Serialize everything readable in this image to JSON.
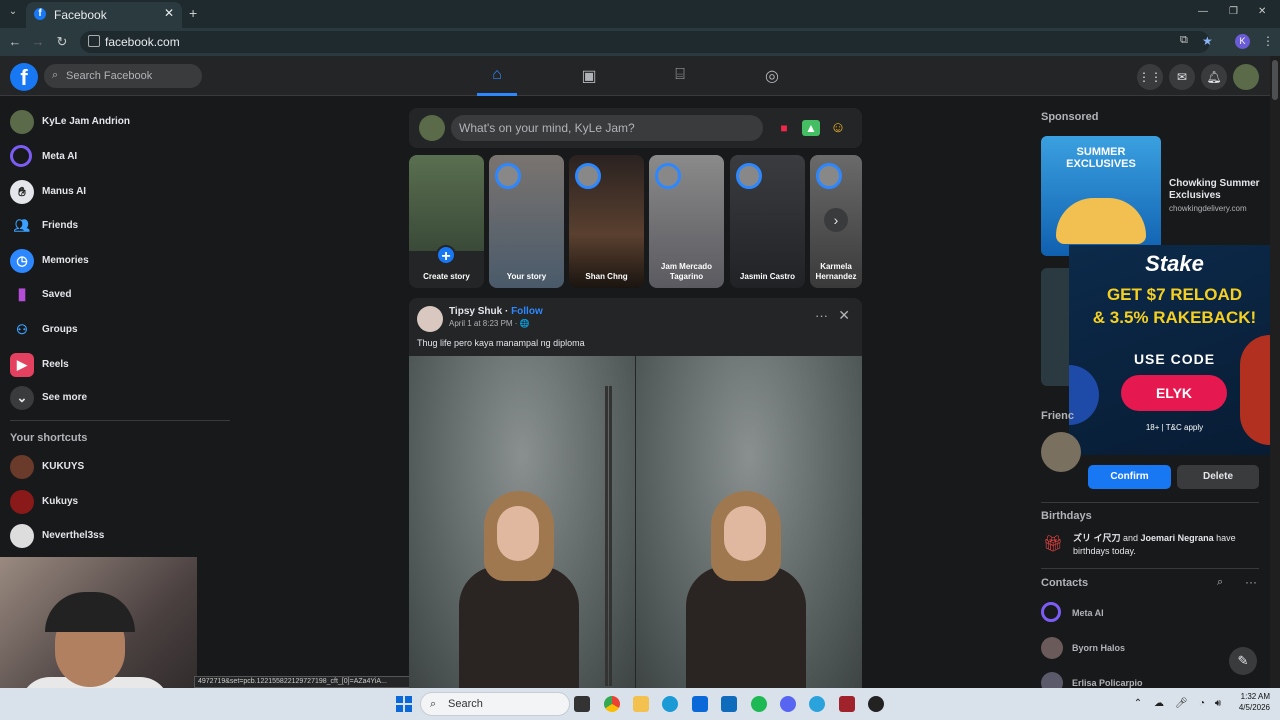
{
  "browser": {
    "tab_title": "Facebook",
    "tab_favicon": "f",
    "new_tab": "+",
    "url": "facebook.com",
    "profile_initial": "K",
    "window_controls": {
      "minimize": "—",
      "restore": "❐",
      "close": "✕"
    }
  },
  "header": {
    "logo": "f",
    "search_placeholder": "Search Facebook",
    "nav": [
      "home-icon",
      "video-icon",
      "marketplace-icon",
      "groups-icon"
    ]
  },
  "sidebar": {
    "items": [
      {
        "label": "KyLe Jam Andrion",
        "icon": "avatar"
      },
      {
        "label": "Meta AI",
        "icon": "meta-ai-icon"
      },
      {
        "label": "Manus AI",
        "icon": "manus-icon"
      },
      {
        "label": "Friends",
        "icon": "friends-icon"
      },
      {
        "label": "Memories",
        "icon": "clock-icon"
      },
      {
        "label": "Saved",
        "icon": "bookmark-icon"
      },
      {
        "label": "Groups",
        "icon": "groups-icon"
      },
      {
        "label": "Reels",
        "icon": "reels-icon"
      },
      {
        "label": "See more",
        "icon": "chevron-down-icon"
      }
    ],
    "shortcuts_title": "Your shortcuts",
    "shortcuts": [
      "KUKUYS",
      "Kukuys",
      "Neverthel3ss"
    ]
  },
  "status_url": "4972719&set=pcb.122155822129727198_cft_[0]=AZa4YiA...",
  "composer": {
    "placeholder": "What's on your mind, KyLe Jam?"
  },
  "stories": [
    {
      "label": "Create story"
    },
    {
      "label": "Your story"
    },
    {
      "label": "Shan Chng"
    },
    {
      "label": "Jam Mercado Tagarino"
    },
    {
      "label": "Jasmin Castro"
    },
    {
      "label": "Karmela Hernandez"
    }
  ],
  "post": {
    "author": "Tipsy Shuk",
    "separator": " · ",
    "follow": "Follow",
    "date": "April 1 at 8:23 PM · ",
    "globe_icon": "🌐",
    "caption": "Thug life pero kaya manampal ng diploma"
  },
  "right": {
    "sponsored": "Sponsored",
    "ad": {
      "image_text": "SUMMER EXCLUSIVES",
      "title": "Chowking Summer Exclusives",
      "domain": "chowkingdelivery.com"
    },
    "stake": {
      "logo": "Stake",
      "line1": "GET $7 RELOAD",
      "line2": "& 3.5% RAKEBACK!",
      "use_code": "USE CODE",
      "code": "ELYK",
      "tc": "18+ | T&C apply"
    },
    "friend_requests_label": "Frienc",
    "confirm": "Confirm",
    "delete": "Delete",
    "birthdays_title": "Birthdays",
    "birthday_name1": "ズリ イ尺刀",
    "birthday_and": " and ",
    "birthday_name2": "Joemari Negrana",
    "birthday_suffix": " have birthdays today.",
    "contacts_title": "Contacts",
    "contacts": [
      "Meta AI",
      "Byorn Halos",
      "Erlisa Policarpio"
    ]
  },
  "taskbar": {
    "search": "Search",
    "time": "1:32 AM",
    "date": "4/5/2026"
  }
}
